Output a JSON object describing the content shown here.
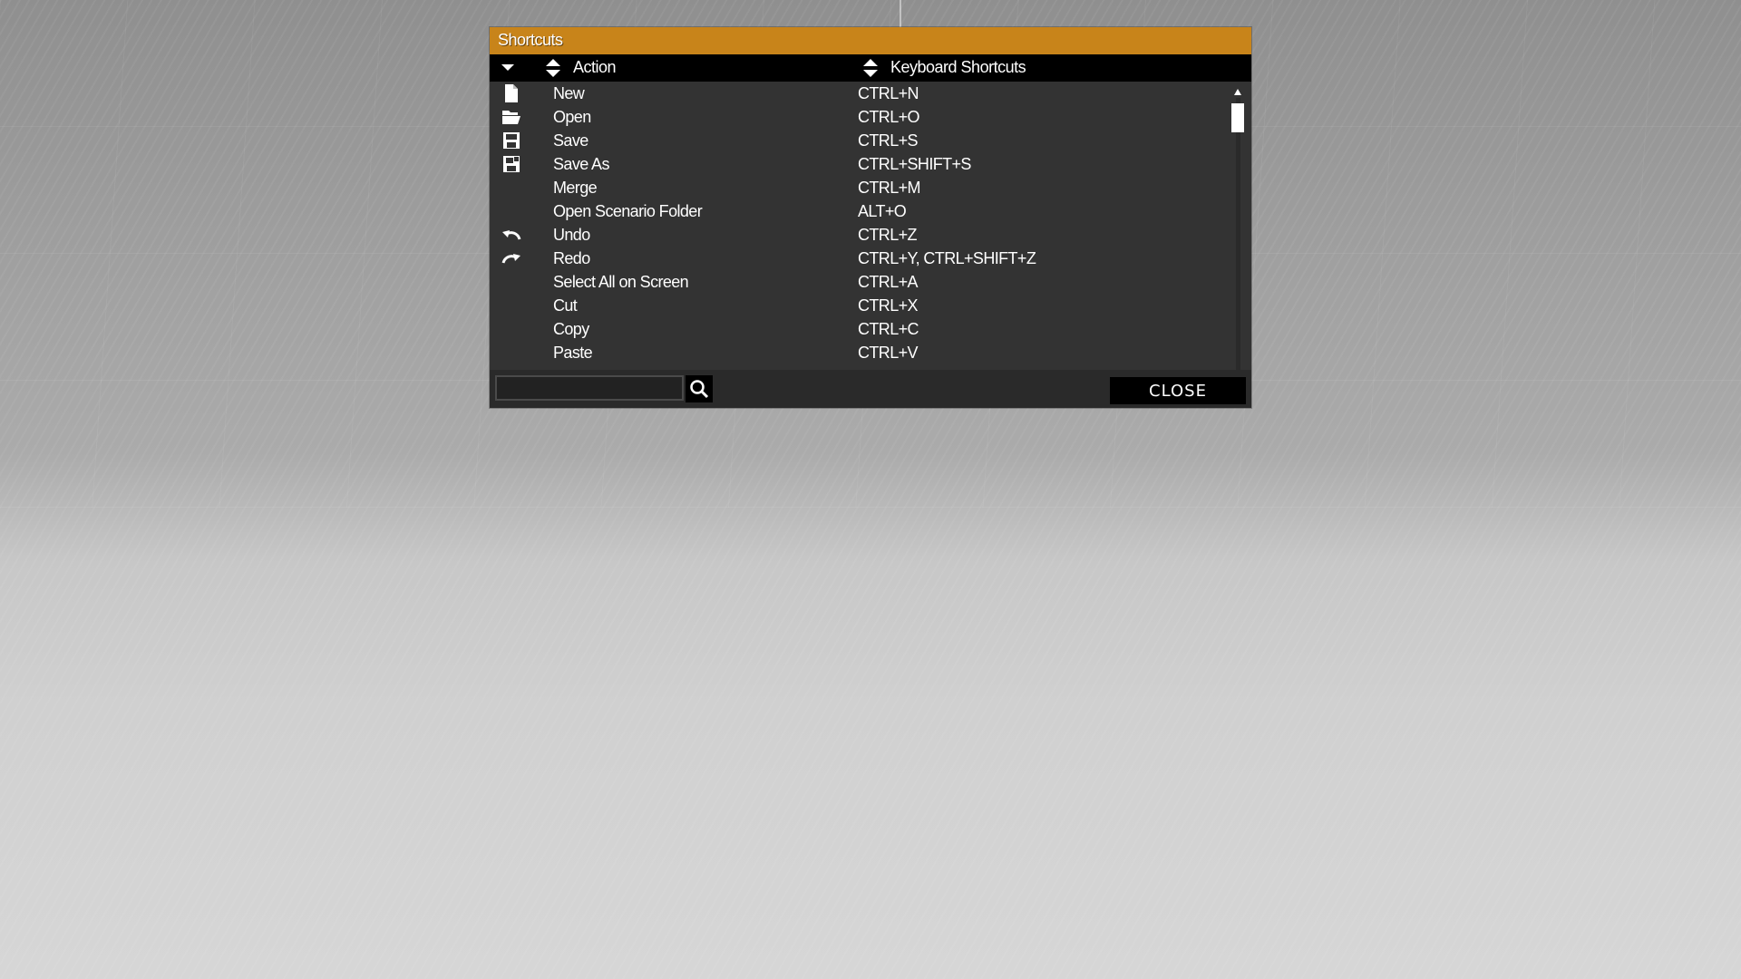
{
  "window": {
    "title": "Shortcuts"
  },
  "header": {
    "dropdown_icon": "chevron-down-icon",
    "sort_icon": "sort-updown-icon",
    "action_label": "Action",
    "shortcut_label": "Keyboard Shortcuts"
  },
  "rows": [
    {
      "icon": "new-file-icon",
      "action": "New",
      "keys": "CTRL+N"
    },
    {
      "icon": "folder-open-icon",
      "action": "Open",
      "keys": "CTRL+O"
    },
    {
      "icon": "save-icon",
      "action": "Save",
      "keys": "CTRL+S"
    },
    {
      "icon": "save-as-icon",
      "action": "Save As",
      "keys": "CTRL+SHIFT+S"
    },
    {
      "icon": "",
      "action": "Merge",
      "keys": "CTRL+M"
    },
    {
      "icon": "",
      "action": "Open Scenario Folder",
      "keys": "ALT+O"
    },
    {
      "icon": "undo-icon",
      "action": "Undo",
      "keys": "CTRL+Z"
    },
    {
      "icon": "redo-icon",
      "action": "Redo",
      "keys": "CTRL+Y, CTRL+SHIFT+Z"
    },
    {
      "icon": "",
      "action": "Select All on Screen",
      "keys": "CTRL+A"
    },
    {
      "icon": "",
      "action": "Cut",
      "keys": "CTRL+X"
    },
    {
      "icon": "",
      "action": "Copy",
      "keys": "CTRL+C"
    },
    {
      "icon": "",
      "action": "Paste",
      "keys": "CTRL+V"
    }
  ],
  "footer": {
    "search_value": "",
    "search_icon": "search-icon",
    "close_label": "CLOSE"
  },
  "colors": {
    "titlebar": "#c8841a",
    "panel": "#333333",
    "header": "#000000",
    "text": "#ffffff"
  }
}
